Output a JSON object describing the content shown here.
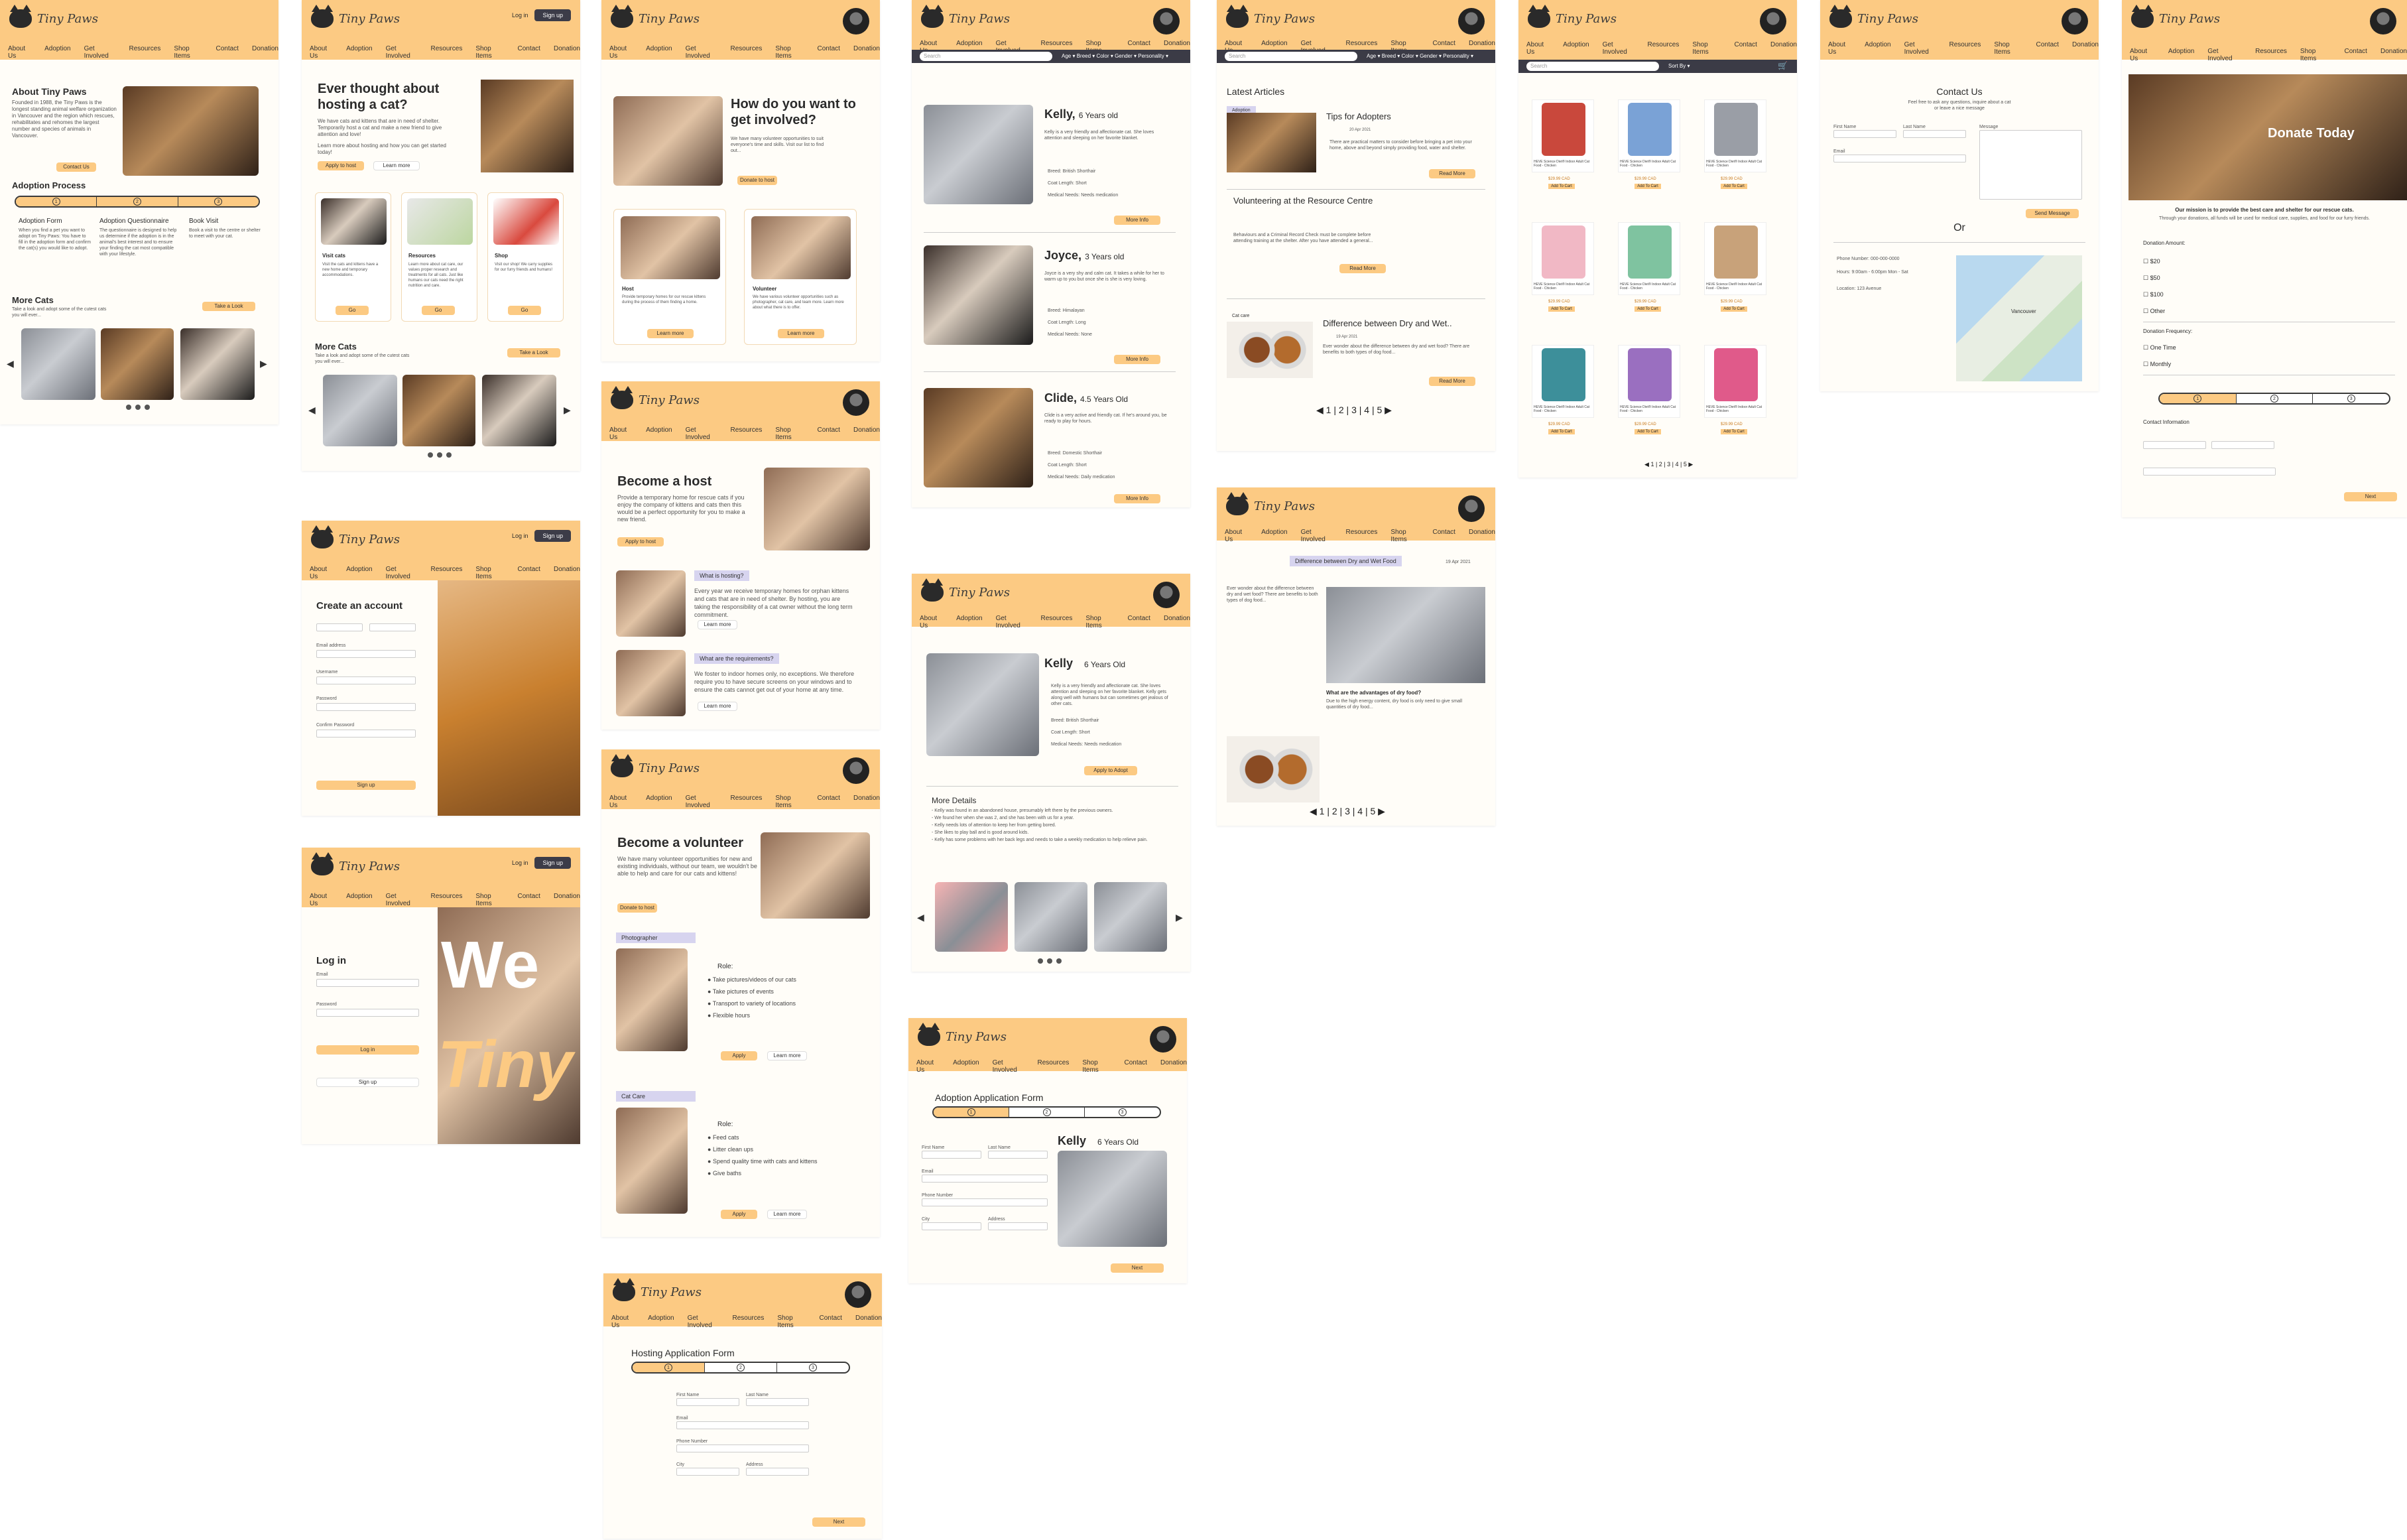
{
  "brand": "Tiny Paws",
  "nav": [
    "About Us",
    "Adoption",
    "Get Involved",
    "Resources",
    "Shop Items",
    "Contact",
    "Donation"
  ],
  "login": "Log in",
  "signup": "Sign up",
  "search_placeholder": "Search",
  "search_filters": "Age ▾   Breed ▾   Color ▾   Gender ▾   Personality ▾",
  "sort_by": "Sort By ▾",
  "home": {
    "about_title": "About Tiny Paws",
    "about_text": "Founded in 1988, the Tiny Paws is the longest standing animal welfare organization in Vancouver and the region which rescues, rehabilitates and rehomes the largest number and species of animals in Vancouver.",
    "contact_btn": "Contact Us",
    "process_title": "Adoption Process",
    "steps": [
      {
        "title": "Adoption Form",
        "text": "When you find a pet you want to adopt on Tiny Paws: You have to fill in the adoption form and confirm the cat(s) you would like to adopt."
      },
      {
        "title": "Adoption Questionnaire",
        "text": "The questionnaire is designed to help us determine if the adoption is in the animal's best interest and to ensure your finding the cat most compatible with your lifestyle."
      },
      {
        "title": "Book Visit",
        "text": "Book a visit to the centre or shelter to meet with your cat."
      }
    ],
    "more_cats": "More Cats",
    "more_cats_sub": "Take a look and adopt some of the cutest cats you will ever...",
    "take_look": "Take a Look"
  },
  "hosting": {
    "title": "Ever thought about hosting a cat?",
    "text": "We have cats and kittens that are in need of shelter. Temporarily host a cat and make a new friend to give attention and love!",
    "text2": "Learn more about hosting and how you can get started today!",
    "apply": "Apply to host",
    "learn": "Learn more",
    "cards": [
      {
        "title": "Visit cats",
        "text": "Visit the cats and kittens have a new home and temporary accommodations."
      },
      {
        "title": "Resources",
        "text": "Learn more about cat care, our values proper research and treatments for all cats. Just like humans our cats need the right nutrition and care."
      },
      {
        "title": "Shop",
        "text": "Visit our shop! We carry supplies for our furry friends and humans!"
      }
    ],
    "go": "Go"
  },
  "involved": {
    "title": "How do you want to get involved?",
    "text": "We have many volunteer opportunities to suit everyone's time and skills. Visit our list to find out...",
    "donate": "Donate to host",
    "host_title": "Host",
    "host_text": "Provide temporary homes for our rescue kittens during the process of them finding a home.",
    "vol_title": "Volunteer",
    "vol_text": "We have various volunteer opportunities such as photographer, cat care, and team more. Learn more about what there is to offer.",
    "learn": "Learn more"
  },
  "become_host": {
    "title": "Become a host",
    "text": "Provide a temporary home for rescue cats if you enjoy the company of kittens and cats then this would be a perfect opportunity for you to make a new friend.",
    "apply": "Apply to host",
    "q1": "What is hosting?",
    "a1": "Every year we receive temporary homes for orphan kittens and cats that are in need of shelter. By hosting, you are taking the responsibility of a cat owner without the long term commitment.",
    "q2": "What are the requirements?",
    "a2": "We foster to indoor homes only, no exceptions. We therefore require you to have secure screens on your windows and to ensure the cats cannot get out of your home at any time.",
    "learn": "Learn more"
  },
  "become_vol": {
    "title": "Become a volunteer",
    "text": "We have many volunteer opportunities for new and existing individuals, without our team, we wouldn't be able to help and care for our cats and kittens!",
    "donate": "Donate to host",
    "photographer": "Photographer",
    "cat_care": "Cat Care",
    "role": "Role:",
    "photo_roles": [
      "Take pictures/videos of our cats",
      "Take pictures of events",
      "Transport to variety of locations",
      "Flexible hours"
    ],
    "care_roles": [
      "Feed cats",
      "Litter clean ups",
      "Spend quality time with cats and kittens",
      "Give baths"
    ],
    "apply": "Apply",
    "learn": "Learn more"
  },
  "create_account": {
    "title": "Create an account",
    "first": "First name",
    "last": "Last name",
    "email": "Email address",
    "username": "Username",
    "password": "Password",
    "confirm": "Confirm Password",
    "signup": "Sign up"
  },
  "login_page": {
    "title": "Log in",
    "email": "Email",
    "password": "Password",
    "login": "Log in",
    "signup": "Sign up",
    "hero_word1": "We",
    "hero_word2": "Tiny"
  },
  "adopt_list": [
    {
      "name": "Kelly,",
      "age": "6 Years old",
      "text": "Kelly is a very friendly and affectionate cat. She loves attention and sleeping on her favorite blanket.",
      "attrs": [
        "Breed: British Shorthair",
        "Coat Length: Short",
        "Medical Needs: Needs medication"
      ]
    },
    {
      "name": "Joyce,",
      "age": "3 Years old",
      "text": "Joyce is a very shy and calm cat. It takes a while for her to warm up to you but once she is she is very loving.",
      "attrs": [
        "Breed: Himalayan",
        "Coat Length: Long",
        "Medical Needs: None"
      ]
    },
    {
      "name": "Clide,",
      "age": "4.5 Years Old",
      "text": "Clide is a very active and friendly cat. If he's around you, be ready to play for hours.",
      "attrs": [
        "Breed: Domestic Shorthair",
        "Coat Length: Short",
        "Medical Needs: Daily medication"
      ]
    }
  ],
  "more_info": "More Info",
  "kelly_detail": {
    "name": "Kelly",
    "age": "6 Years Old",
    "text": "Kelly is a very friendly and affectionate cat. She loves attention and sleeping on her favorite blanket. Kelly gets along well with humans but can sometimes get jealous of other cats.",
    "attrs": [
      "Breed: British Shorthair",
      "Coat Length: Short",
      "Medical Needs: Needs medication"
    ],
    "apply": "Apply to Adopt",
    "more": "More Details",
    "details": [
      "Kelly was found in an abandoned house, presumably left there by the previous owners.",
      "We found her when she was 2, and she has been with us for a year.",
      "Kelly needs lots of attention to keep her from getting bored.",
      "She likes to play ball and is good around kids.",
      "Kelly has some problems with her back legs and needs to take a weekly medication to help relieve pain."
    ]
  },
  "articles": {
    "title": "Latest Articles",
    "a1_tag": "Adoption",
    "a1_title": "Tips for Adopters",
    "a1_date": "20 Apr 2021",
    "a1_text": "There are practical matters to consider before bringing a pet into your home, above and beyond simply providing food, water and shelter.",
    "a2_title": "Volunteering at the Resource Centre",
    "a2_text": "Behaviours and a Criminal Record Check must be complete before attending training at the shelter. After you have attended a general...",
    "a3_tag": "Cat care",
    "a3_title": "Difference between Dry and Wet..",
    "a3_date": "19 Apr 2021",
    "a3_text": "Ever wonder about the difference between dry and wet food? There are benefits to both types of dog food...",
    "read": "Read More",
    "pages": "1 | 2 | 3 | 4 | 5"
  },
  "article_detail": {
    "tag": "Difference between Dry and Wet Food",
    "date": "19 Apr 2021",
    "text": "Ever wonder about the difference between dry and wet food? There are benefits to both types of dog food...",
    "q": "What are the advantages of dry food?",
    "text2": "Due to the high energy content, dry food is only need to give small quantities of dry food...",
    "pages": "1 | 2 | 3 | 4 | 5"
  },
  "shop": {
    "product": "HEVE Science Diet® Indoor Adult Cat Food - Chicken",
    "price": "$29.99 CAD",
    "add": "Add To Cart",
    "pages": "1 | 2 | 3 | 4 | 5"
  },
  "contact": {
    "title": "Contact Us",
    "sub": "Feel free to ask any questions, inquire about a cat or leave a nice message",
    "first": "First Name",
    "last": "Last Name",
    "email": "Email",
    "message": "Message",
    "send": "Send Message",
    "or": "Or",
    "phone": "Phone Number: 000-000-0000",
    "hours": "Hours: 9:00am - 6:00pm Mon - Sat",
    "location": "Location: 123 Avenue",
    "city": "Vancouver"
  },
  "donate": {
    "hero": "Donate Today",
    "mission": "Our mission is to provide the best care and shelter for our rescue cats.",
    "mission2": "Through your donations, all funds will be used for medical care, supplies, and food for our furry friends.",
    "amount": "Donation Amount:",
    "amounts": [
      "$20",
      "$50",
      "$100",
      "Other"
    ],
    "freq": "Donation Frequency:",
    "freqs": [
      "One Time",
      "Monthly"
    ],
    "contact": "Contact Information",
    "next": "Next"
  },
  "adopt_form": {
    "title": "Adoption Application Form",
    "name": "Kelly",
    "age": "6 Years Old",
    "first": "First Name",
    "last": "Last Name",
    "email": "Email",
    "phone": "Phone Number",
    "city": "City",
    "address": "Address",
    "next": "Next"
  },
  "host_form": {
    "title": "Hosting Application Form",
    "first": "First Name",
    "last": "Last Name",
    "email": "Email",
    "phone": "Phone Number",
    "city": "City",
    "address": "Address",
    "next": "Next"
  }
}
